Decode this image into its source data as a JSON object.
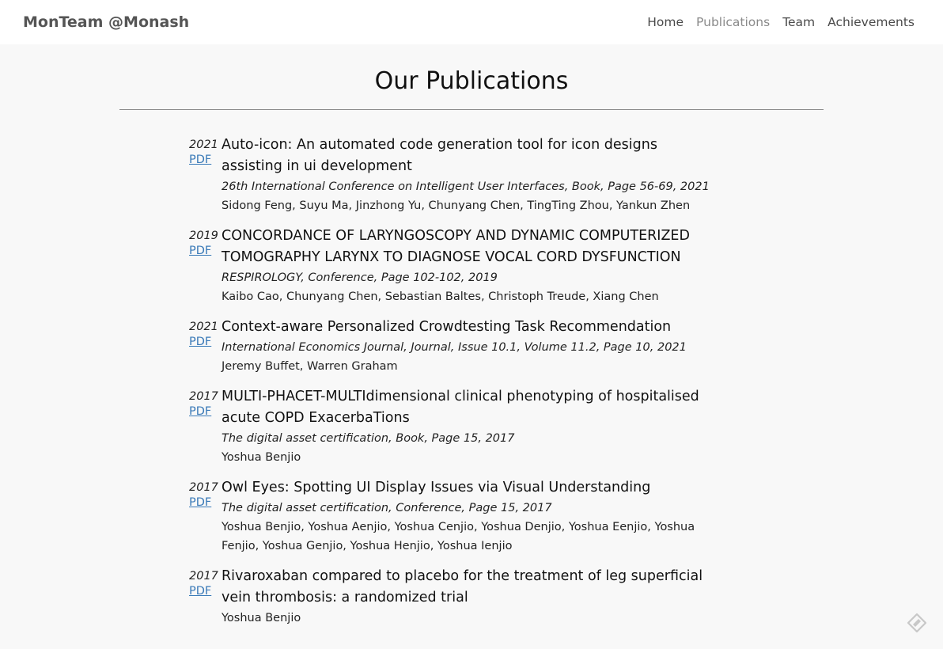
{
  "nav": {
    "brand": "MonTeam @Monash",
    "links": [
      {
        "label": "Home",
        "active": false
      },
      {
        "label": "Publications",
        "active": true
      },
      {
        "label": "Team",
        "active": false
      },
      {
        "label": "Achievements",
        "active": false
      }
    ]
  },
  "page": {
    "title": "Our Publications"
  },
  "publications": [
    {
      "year": "2021",
      "pdf_label": "PDF",
      "title": "Auto-icon: An automated code generation tool for icon designs assisting in ui development",
      "venue": "26th International Conference on Intelligent User Interfaces, Book, Page 56-69, 2021",
      "authors": "Sidong Feng, Suyu Ma, Jinzhong Yu, Chunyang Chen, TingTing Zhou, Yankun Zhen"
    },
    {
      "year": "2019",
      "pdf_label": "PDF",
      "title": "CONCORDANCE OF LARYNGOSCOPY AND DYNAMIC COMPUTERIZED TOMOGRAPHY LARYNX TO DIAGNOSE VOCAL CORD DYSFUNCTION",
      "venue": "RESPIROLOGY, Conference, Page 102-102, 2019",
      "authors": "Kaibo Cao, Chunyang Chen, Sebastian Baltes, Christoph Treude, Xiang Chen"
    },
    {
      "year": "2021",
      "pdf_label": "PDF",
      "title": "Context-aware Personalized Crowdtesting Task Recommendation",
      "venue": "International Economics Journal, Journal, Issue 10.1, Volume 11.2, Page 10, 2021",
      "authors": "Jeremy Buffet, Warren Graham"
    },
    {
      "year": "2017",
      "pdf_label": "PDF",
      "title": "MULTI-PHACET-MULTIdimensional clinical phenotyping of hospitalised acute COPD ExacerbaTions",
      "venue": "The digital asset certification, Book, Page 15, 2017",
      "authors": "Yoshua Benjio"
    },
    {
      "year": "2017",
      "pdf_label": "PDF",
      "title": "Owl Eyes: Spotting UI Display Issues via Visual Understanding",
      "venue": "The digital asset certification, Conference, Page 15, 2017",
      "authors": "Yoshua Benjio, Yoshua Aenjio, Yoshua Cenjio, Yoshua Denjio, Yoshua Eenjio, Yoshua Fenjio, Yoshua Genjio, Yoshua Henjio, Yoshua Ienjio"
    },
    {
      "year": "2017",
      "pdf_label": "PDF",
      "title": "Rivaroxaban compared to placebo for the treatment of leg superficial vein thrombosis: a randomized trial",
      "venue": "",
      "authors": "Yoshua Benjio"
    }
  ],
  "colors": {
    "link": "#3a7ab8",
    "nav_active": "#8a8a8a",
    "background": "#f8f8f8"
  },
  "icons": {
    "corner": "edit-pencil-icon"
  }
}
